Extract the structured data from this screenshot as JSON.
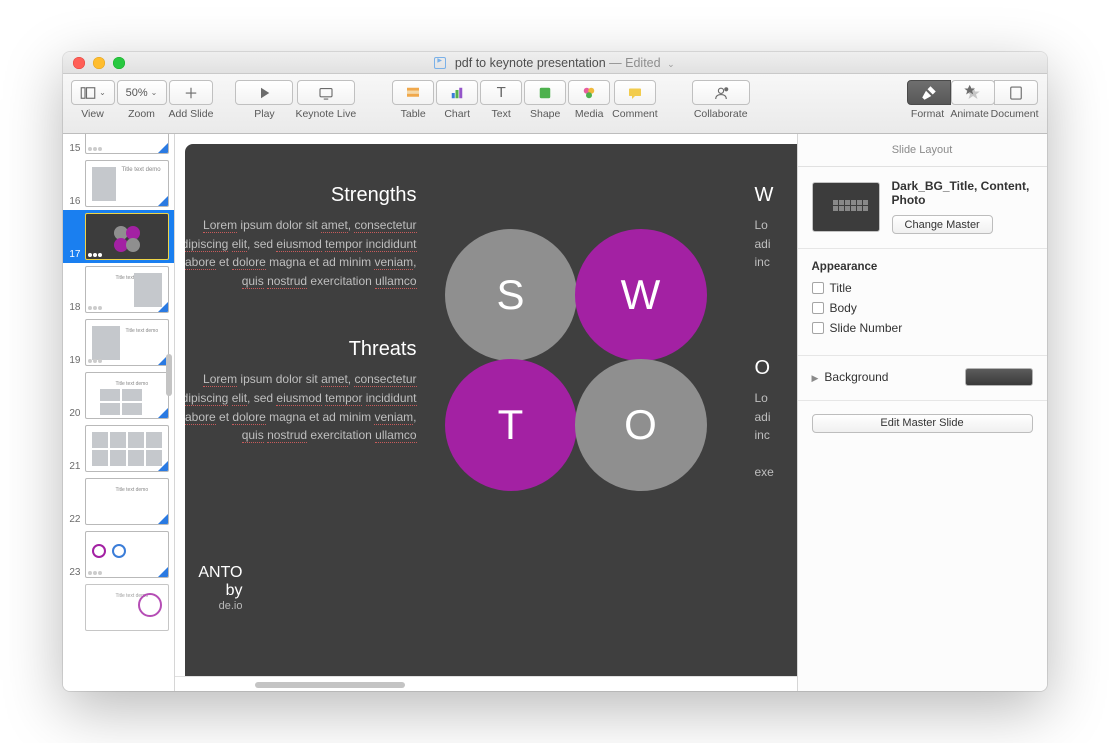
{
  "window": {
    "title": "pdf to keynote presentation",
    "edited": "— Edited"
  },
  "toolbar": {
    "view": "View",
    "zoom_label": "Zoom",
    "zoom_value": "50%",
    "add_slide": "Add Slide",
    "play": "Play",
    "keynote_live": "Keynote Live",
    "table": "Table",
    "chart": "Chart",
    "text": "Text",
    "shape": "Shape",
    "media": "Media",
    "comment": "Comment",
    "collaborate": "Collaborate",
    "format": "Format",
    "animate": "Animate",
    "document": "Document"
  },
  "thumbs": [
    {
      "num": "15"
    },
    {
      "num": "16"
    },
    {
      "num": "17"
    },
    {
      "num": "18"
    },
    {
      "num": "19"
    },
    {
      "num": "20"
    },
    {
      "num": "21"
    },
    {
      "num": "22"
    },
    {
      "num": "23"
    }
  ],
  "slide": {
    "strengths_h": "Strengths",
    "threats_h": "Threats",
    "weak_h": "W",
    "opp_h": "O",
    "s_letter": "S",
    "w_letter": "W",
    "t_letter": "T",
    "o_letter": "O",
    "lorem": "Lorem ipsum dolor sit amet, consectetur adipiscing elit, sed eiusmod tempor incididunt ulabore et dolore magna et ad minim veniam, quis nostrud exercitation ullamco",
    "right_trunc": "Lo",
    "foot_a": "ANTO by",
    "foot_b": "de.io"
  },
  "inspector": {
    "slide_layout": "Slide Layout",
    "master_name": "Dark_BG_Title, Content, Photo",
    "change_master": "Change Master",
    "appearance": "Appearance",
    "title": "Title",
    "body": "Body",
    "slide_number": "Slide Number",
    "background": "Background",
    "edit_master": "Edit Master Slide"
  }
}
